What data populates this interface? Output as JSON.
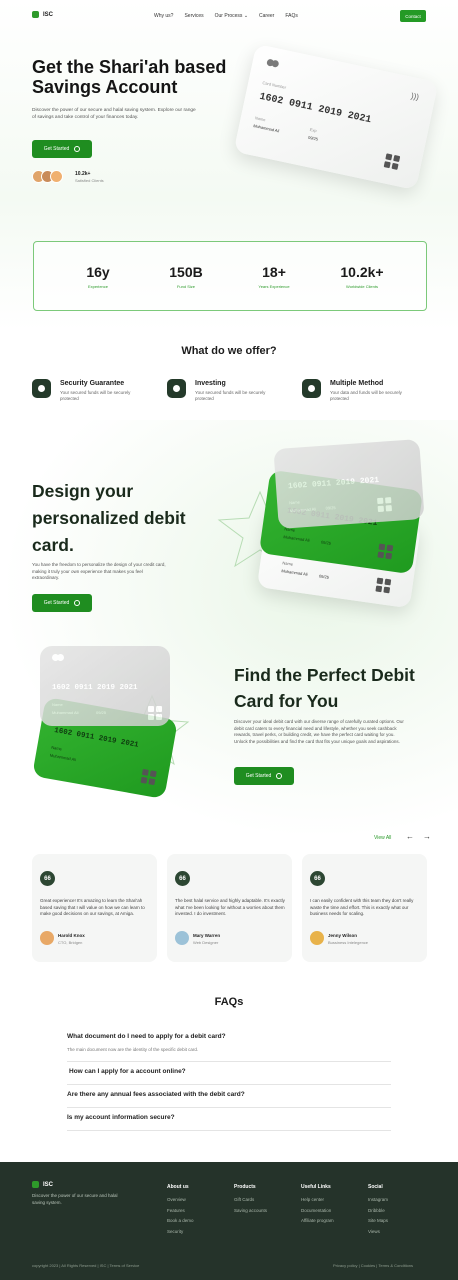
{
  "brand": {
    "name": "ISC",
    "accent": "#249a25",
    "dark": "#25332a"
  },
  "nav": {
    "items": [
      "Why us?",
      "Services",
      "Our Process",
      "Career",
      "FAQs"
    ],
    "dropdown_icon": "chevron-down-icon",
    "contact_label": "Contact"
  },
  "hero": {
    "title": "Get the Shari'ah based Savings Account",
    "subtitle": "Discover the power of our secure and halal saving system. Explore our range of savings and take control of your finances today.",
    "cta_label": "Get Started",
    "clients_count": "10.2k+",
    "clients_label": "Satisfied Clients"
  },
  "card": {
    "label": "Card Number",
    "number": "1602 0911 2019 2021",
    "name_label": "Name",
    "name_value": "Muhammad Ali",
    "exp_label": "Exp",
    "exp_value": "09/25"
  },
  "stats": [
    {
      "value": "16y",
      "label": "Experience"
    },
    {
      "value": "150B",
      "label": "Fund Size"
    },
    {
      "value": "18+",
      "label": "Years Experience"
    },
    {
      "value": "10.2k+",
      "label": "Worldwide Clients"
    }
  ],
  "offer": {
    "title": "What do we offer?",
    "features": [
      {
        "title": "Security Guarantee",
        "desc": "Your secured funds will be securely protected",
        "icon": "shield-icon"
      },
      {
        "title": "Investing",
        "desc": "Your secured funds will be securely protected",
        "icon": "pie-chart-icon"
      },
      {
        "title": "Multiple Method",
        "desc": "Your data and funds will be securely protected",
        "icon": "bar-chart-icon"
      }
    ]
  },
  "design": {
    "title": "Design your personalized debit card.",
    "subtitle": "You have the freedom to personalize the design of your credit card, making it truly your own experience that makes you feel extraordinary.",
    "cta_label": "Get Started"
  },
  "find": {
    "title": "Find the Perfect Debit Card for You",
    "subtitle": "Discover your ideal debit card with our diverse range of carefully curated options. Our debit card caters to every financial need and lifestyle, whether you seek cashback rewards, travel perks, or building credit, we have the perfect card waiting for you. Unlock the possibilities and find the card that fits your unique goals and aspirations.",
    "cta_label": "Get Started"
  },
  "testimonials": {
    "view_all": "View All",
    "items": [
      {
        "quote": "Great experience! It's amazing to learn the Shari'ah based saving that I will value on how we can learn to make good decisions on our savings, at Amiga.",
        "name": "Harold Knox",
        "role": "CTO, Bridgen"
      },
      {
        "quote": "The best halal service and highly adaptable. It's exactly what I've been looking for without a worries about them invested. I do investment.",
        "name": "Mary Warren",
        "role": "Web Designer"
      },
      {
        "quote": "I can easily confident with this team they don't really waste the time and effort. This is exactly what our business needs for scaling.",
        "name": "Jenny Wilson",
        "role": "Bussiness Intelegence"
      }
    ]
  },
  "faq": {
    "title": "FAQs",
    "items": [
      {
        "q": "What document do I need to apply for a debit card?",
        "a": "The main document now are the identity of the specific debit card."
      },
      {
        "q": "How can I apply for a account online?"
      },
      {
        "q": "Are there any annual fees associated with the debit card?"
      },
      {
        "q": "Is my account information secure?"
      }
    ]
  },
  "footer": {
    "desc": "Discover the power of our secure and halal saving system.",
    "columns": [
      {
        "title": "About us",
        "links": [
          "Overview",
          "Features",
          "Book a demo",
          "Security"
        ]
      },
      {
        "title": "Products",
        "links": [
          "Gift Cards",
          "Saving accounts"
        ]
      },
      {
        "title": "Useful Links",
        "links": [
          "Help center",
          "Documentation",
          "Affiliate program"
        ]
      },
      {
        "title": "Social",
        "links": [
          "Instagram",
          "Dribbble",
          "Site Maps",
          "Views"
        ]
      }
    ],
    "copyright": "copyright 2023 | All Rights Reserved | ISC | Terms of Service",
    "right": "Privacy policy | Cookies | Terms & Conditions"
  }
}
